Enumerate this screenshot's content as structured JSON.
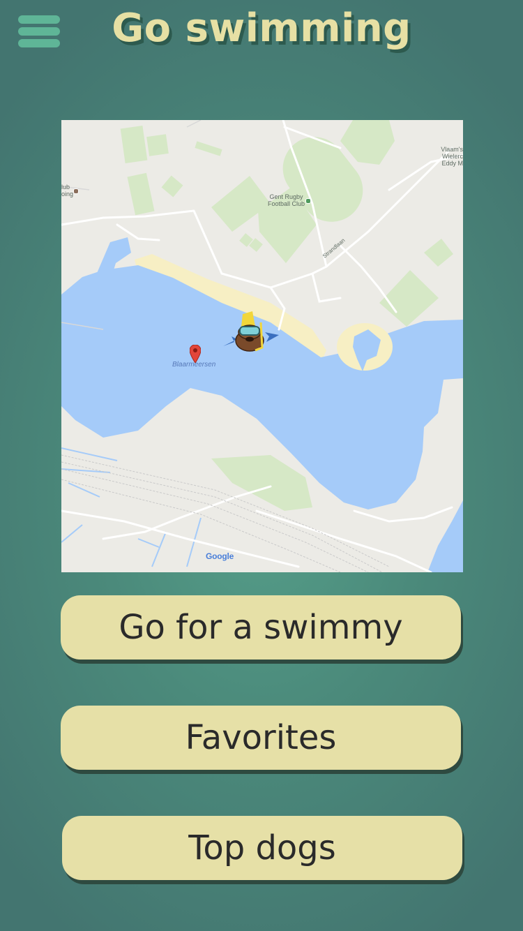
{
  "header": {
    "title": "Go swimming",
    "menu_icon": "hamburger-menu-icon"
  },
  "map": {
    "place_name": "Blaarmeersen",
    "poi_labels": {
      "rugby_club_line1": "Gent Rugby",
      "rugby_club_line2": "Football Club",
      "wielercentrum_line1": "Vlaam's Wielerc",
      "wielercentrum_line2": "Eddy M",
      "left_poi_line1": "lub",
      "left_poi_line2": "oing",
      "street": "Strandlaan"
    },
    "attribution": "Google",
    "marker_icon": "red-map-pin-icon",
    "mascot_icon": "snorkel-dog-emoji-icon",
    "colors": {
      "water": "#a5cbf9",
      "land": "#ecebe6",
      "park": "#d6e8c6",
      "beach": "#f7efc4"
    }
  },
  "buttons": {
    "swim": "Go for a swimmy",
    "favorites": "Favorites",
    "top_dogs": "Top dogs"
  },
  "colors": {
    "accent": "#e6e0a7",
    "menu_icon": "#5fb597",
    "background": "#4b8a7b"
  }
}
